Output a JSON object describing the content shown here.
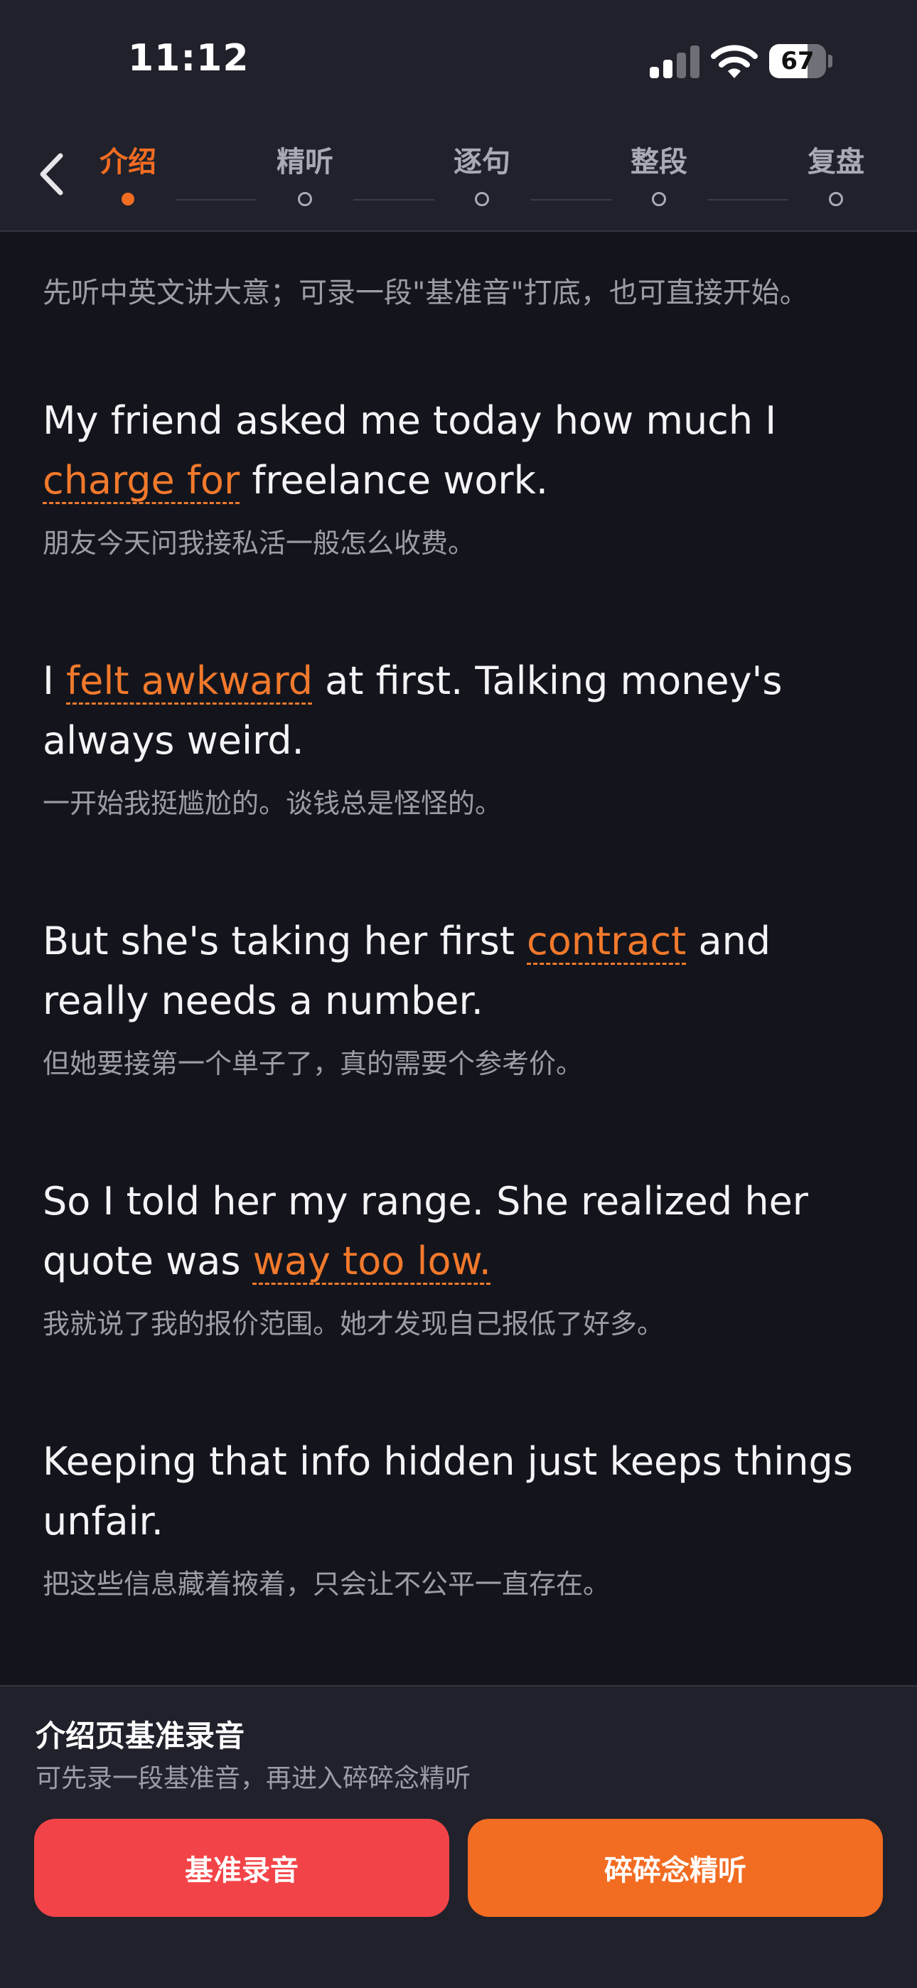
{
  "status_bar": {
    "time": "11:12",
    "battery_level": "67",
    "battery_fraction": 0.67,
    "icons": [
      "cellular-signal-icon",
      "wifi-icon",
      "battery-icon"
    ]
  },
  "nav": {
    "back_icon": "chevron-left-icon",
    "tabs": [
      {
        "label": "介绍",
        "active": true
      },
      {
        "label": "精听",
        "active": false
      },
      {
        "label": "逐句",
        "active": false
      },
      {
        "label": "整段",
        "active": false
      },
      {
        "label": "复盘",
        "active": false
      }
    ]
  },
  "intro": "先听中英文讲大意；可录一段\"基准音\"打底，也可直接开始。",
  "sentences": [
    {
      "en": [
        {
          "text": "My friend asked me today how much I "
        },
        {
          "text": "charge for",
          "highlight": true
        },
        {
          "text": " freelance work."
        }
      ],
      "zh": "朋友今天问我接私活一般怎么收费。"
    },
    {
      "en": [
        {
          "text": "I "
        },
        {
          "text": "felt awkward",
          "highlight": true
        },
        {
          "text": " at first. Talking money's always weird."
        }
      ],
      "zh": "一开始我挺尴尬的。谈钱总是怪怪的。"
    },
    {
      "en": [
        {
          "text": "But she's taking her first "
        },
        {
          "text": "contract",
          "highlight": true
        },
        {
          "text": " and really needs a number."
        }
      ],
      "zh": "但她要接第一个单子了，真的需要个参考价。"
    },
    {
      "en": [
        {
          "text": "So I told her my range. She realized her quote was "
        },
        {
          "text": "way too low.",
          "highlight": true
        }
      ],
      "zh": "我就说了我的报价范围。她才发现自己报低了好多。"
    },
    {
      "en": [
        {
          "text": "Keeping that info hidden just keeps things unfair."
        }
      ],
      "zh": "把这些信息藏着掖着，只会让不公平一直存在。"
    }
  ],
  "panel": {
    "title": "介绍页基准录音",
    "subtitle": "可先录一段基准音，再进入碎碎念精听",
    "record_button": "基准录音",
    "listen_button": "碎碎念精听"
  },
  "colors": {
    "accent": "#f26c22",
    "record_button": "#f24448",
    "background": "#14151c",
    "header": "#20212b"
  }
}
